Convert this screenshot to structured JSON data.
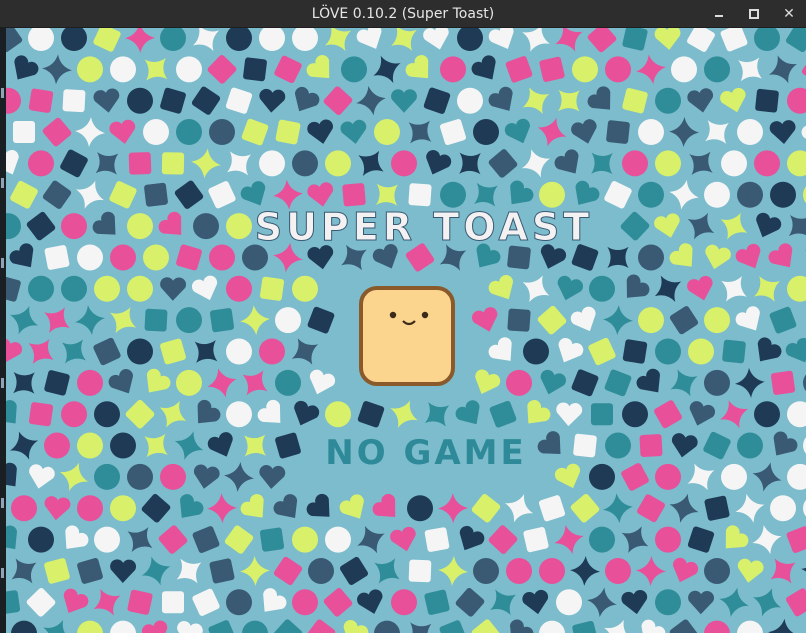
{
  "window": {
    "title": "LÖVE 0.10.2 (Super Toast)",
    "controls": {
      "minimize": "minimize",
      "maximize": "maximize",
      "close": "✕"
    }
  },
  "game_screen": {
    "logo_text": "SUPER TOAST",
    "message_text": "NO GAME",
    "background_color": "#7cbccc",
    "pattern_colors": [
      "#e8509a",
      "#d9f06a",
      "#f5f5f5",
      "#3a5a73",
      "#2f8d99",
      "#1f3a55"
    ],
    "logo_color": "#f4f1f3",
    "message_color": "#2e8a98",
    "toast_color": "#fbd48e",
    "toast_crust_color": "#8a5a2b"
  }
}
